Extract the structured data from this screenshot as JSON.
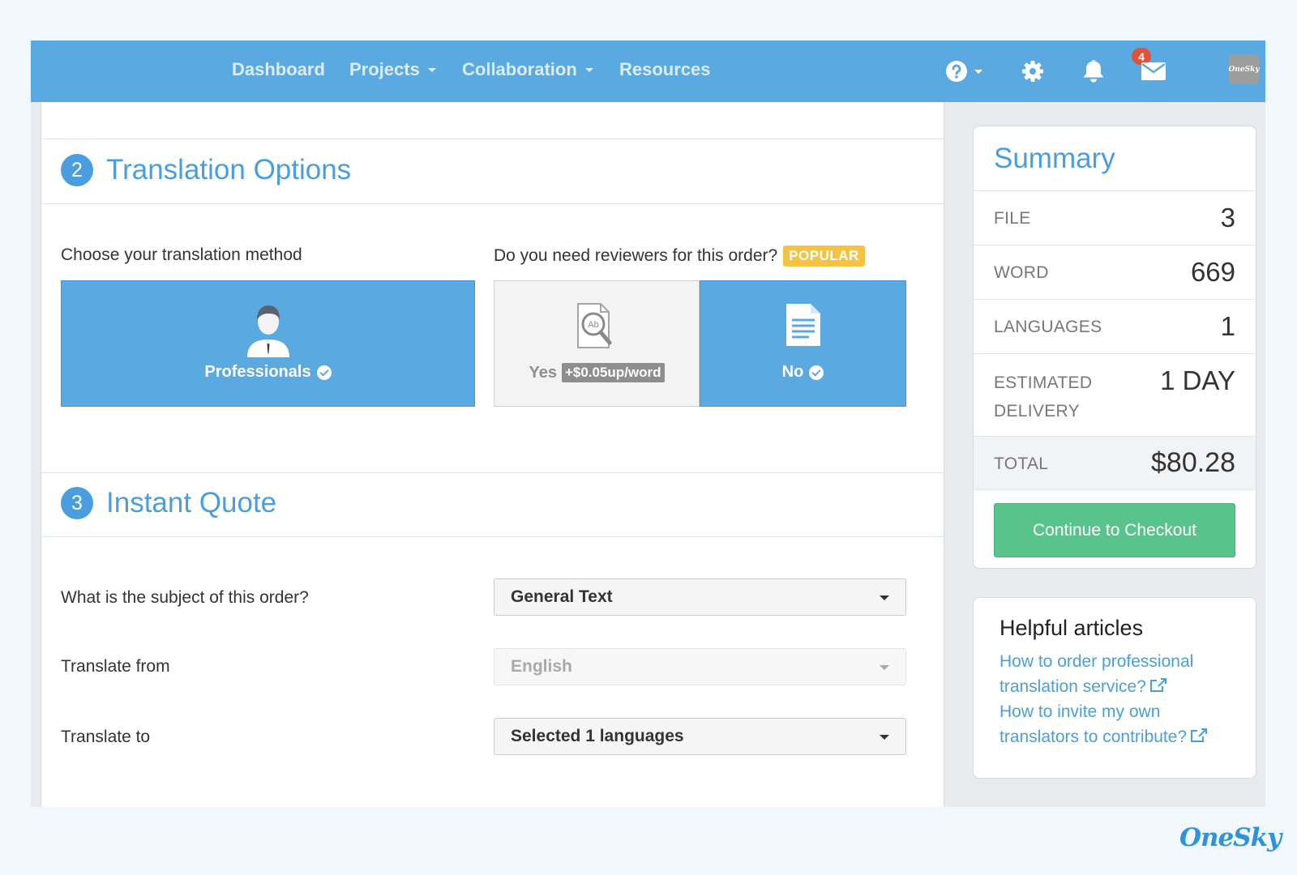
{
  "nav": {
    "items": [
      {
        "label": "Dashboard",
        "dropdown": false
      },
      {
        "label": "Projects",
        "dropdown": true
      },
      {
        "label": "Collaboration",
        "dropdown": true
      },
      {
        "label": "Resources",
        "dropdown": false
      }
    ],
    "icons": [
      "help-icon",
      "gear-icon",
      "bell-icon",
      "mail-icon"
    ],
    "notification_count": "4",
    "avatar_text": "OneSky"
  },
  "translation_options": {
    "step": "2",
    "title": "Translation Options",
    "method_label": "Choose your translation method",
    "method_option": "Professionals",
    "reviewers_label": "Do you need reviewers for this order?",
    "popular_badge": "POPULAR",
    "reviewer_yes": "Yes",
    "reviewer_yes_price": "+$0.05up/word",
    "reviewer_no": "No",
    "selected": {
      "method": "Professionals",
      "reviewers": "No"
    }
  },
  "instant_quote": {
    "step": "3",
    "title": "Instant Quote",
    "subject_label": "What is the subject of this order?",
    "subject_value": "General Text",
    "from_label": "Translate from",
    "from_value": "English",
    "to_label": "Translate to",
    "to_value": "Selected 1 languages"
  },
  "summary": {
    "title": "Summary",
    "rows": [
      {
        "key": "FILE",
        "value": "3"
      },
      {
        "key": "WORD",
        "value": "669"
      },
      {
        "key": "LANGUAGES",
        "value": "1"
      },
      {
        "key": "ESTIMATED DELIVERY",
        "value": "1 DAY"
      }
    ],
    "total_label": "TOTAL",
    "total_value": "$80.28",
    "checkout_label": "Continue to Checkout"
  },
  "helpful_articles": {
    "title": "Helpful articles",
    "links": [
      "How to order professional translation service?",
      "How to invite my own translators to contribute?"
    ]
  },
  "brand": "OneSky",
  "colors": {
    "primary": "#5aa9e0",
    "accent_text": "#4a9ee0",
    "success": "#58c48c",
    "badge_red": "#e0533a",
    "popular_yellow": "#f5c342"
  }
}
